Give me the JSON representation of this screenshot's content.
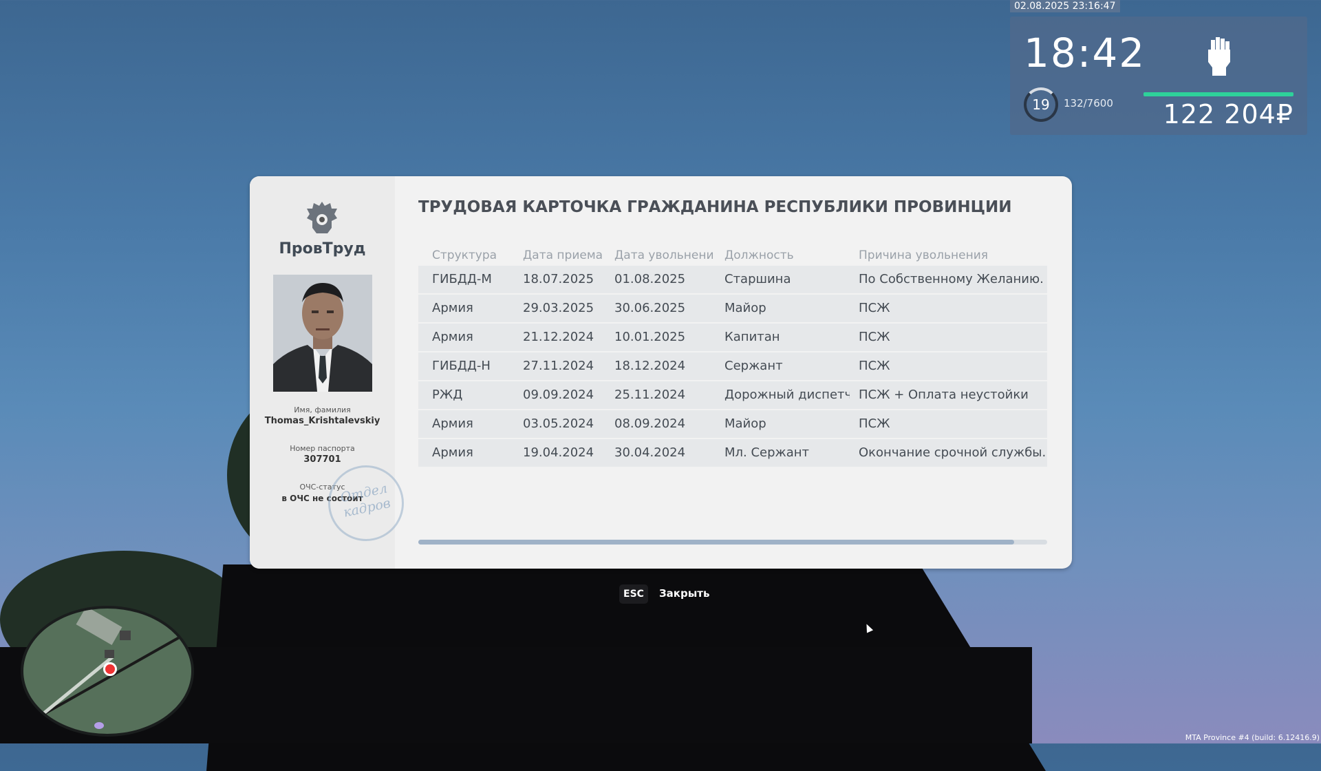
{
  "hud": {
    "datetime": "02.08.2025 23:16:47",
    "time": "18:42",
    "level": "19",
    "xp": "132/7600",
    "money": "122 204₽",
    "icons": [
      "fist-icon"
    ]
  },
  "card": {
    "org_name": "ПровТруд",
    "title": "ТРУДОВАЯ КАРТОЧКА ГРАЖДАНИНА РЕСПУБЛИКИ ПРОВИНЦИИ",
    "name_label": "Имя, фамилия",
    "name_value": "Thomas_Krishtalevskiy",
    "passport_label": "Номер паспорта",
    "passport_value": "307701",
    "ochs_label": "ОЧС-статус",
    "ochs_value": "в ОЧС не состоит",
    "stamp_text": "Отдел кадров",
    "columns": [
      "Структура",
      "Дата приема",
      "Дата увольнени",
      "Должность",
      "Причина увольнения"
    ],
    "rows": [
      [
        "ГИБДД-М",
        "18.07.2025",
        "01.08.2025",
        "Старшина",
        "По Собственному Желанию."
      ],
      [
        "Армия",
        "29.03.2025",
        "30.06.2025",
        "Майор",
        "ПСЖ"
      ],
      [
        "Армия",
        "21.12.2024",
        "10.01.2025",
        "Капитан",
        "ПСЖ"
      ],
      [
        "ГИБДД-Н",
        "27.11.2024",
        "18.12.2024",
        "Сержант",
        "ПСЖ"
      ],
      [
        "РЖД",
        "09.09.2024",
        "25.11.2024",
        "Дорожный диспетчер",
        "ПСЖ + Оплата неустойки"
      ],
      [
        "Армия",
        "03.05.2024",
        "08.09.2024",
        "Майор",
        "ПСЖ"
      ],
      [
        "Армия",
        "19.04.2024",
        "30.04.2024",
        "Мл. Сержант",
        "Окончание срочной службы."
      ]
    ]
  },
  "close": {
    "key": "ESC",
    "label": "Закрыть"
  },
  "footer": "MTA Province #4 (build: 6.12416.9)",
  "colors": {
    "hud_bar": "#2ed19a",
    "card_bg": "#f2f2f2",
    "scroll_thumb": "#9fb2c7"
  }
}
